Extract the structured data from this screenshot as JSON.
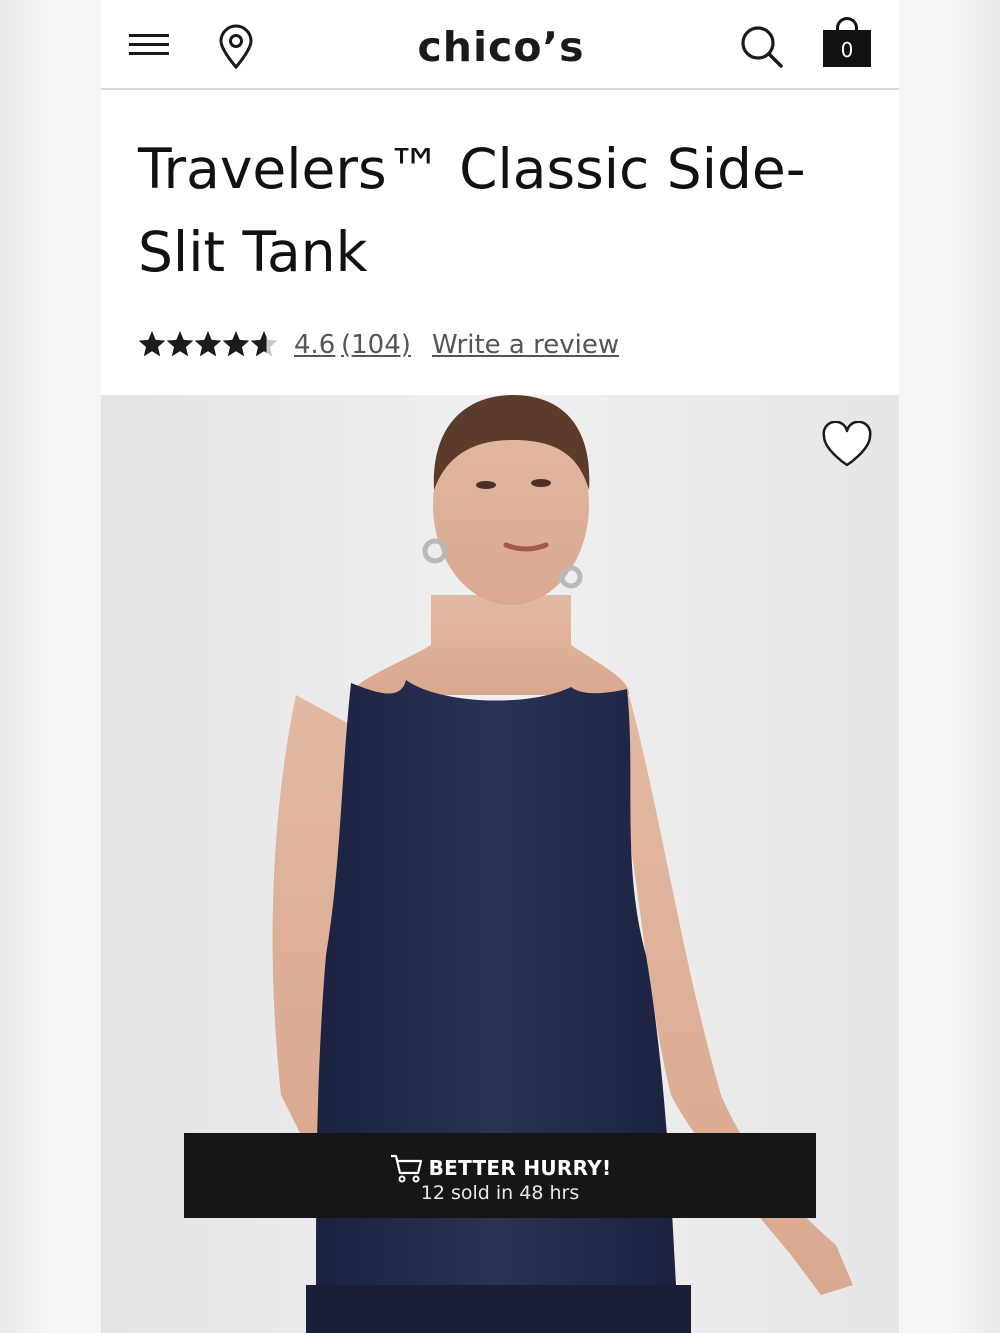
{
  "header": {
    "logo_text": "chico’s",
    "bag_count": "0",
    "icons": [
      "menu-icon",
      "location-pin-icon",
      "search-icon",
      "shopping-bag-icon"
    ]
  },
  "product": {
    "title": "Travelers™ Classic Side-Slit Tank",
    "rating": {
      "stars": 4.6,
      "max_stars": 5,
      "value_text": "4.6",
      "count_text": "(104)",
      "write_review_label": "Write a review"
    },
    "image": {
      "wishlist_icon": "heart-outline-icon",
      "garment_color": "#232a4a"
    }
  },
  "urgency_banner": {
    "icon": "shopping-cart-icon",
    "headline": "BETTER HURRY!",
    "subtext": "12 sold in 48 hrs"
  },
  "colors": {
    "text": "#1a1a1a",
    "banner_bg": "#161616",
    "link_gray": "#555555"
  }
}
